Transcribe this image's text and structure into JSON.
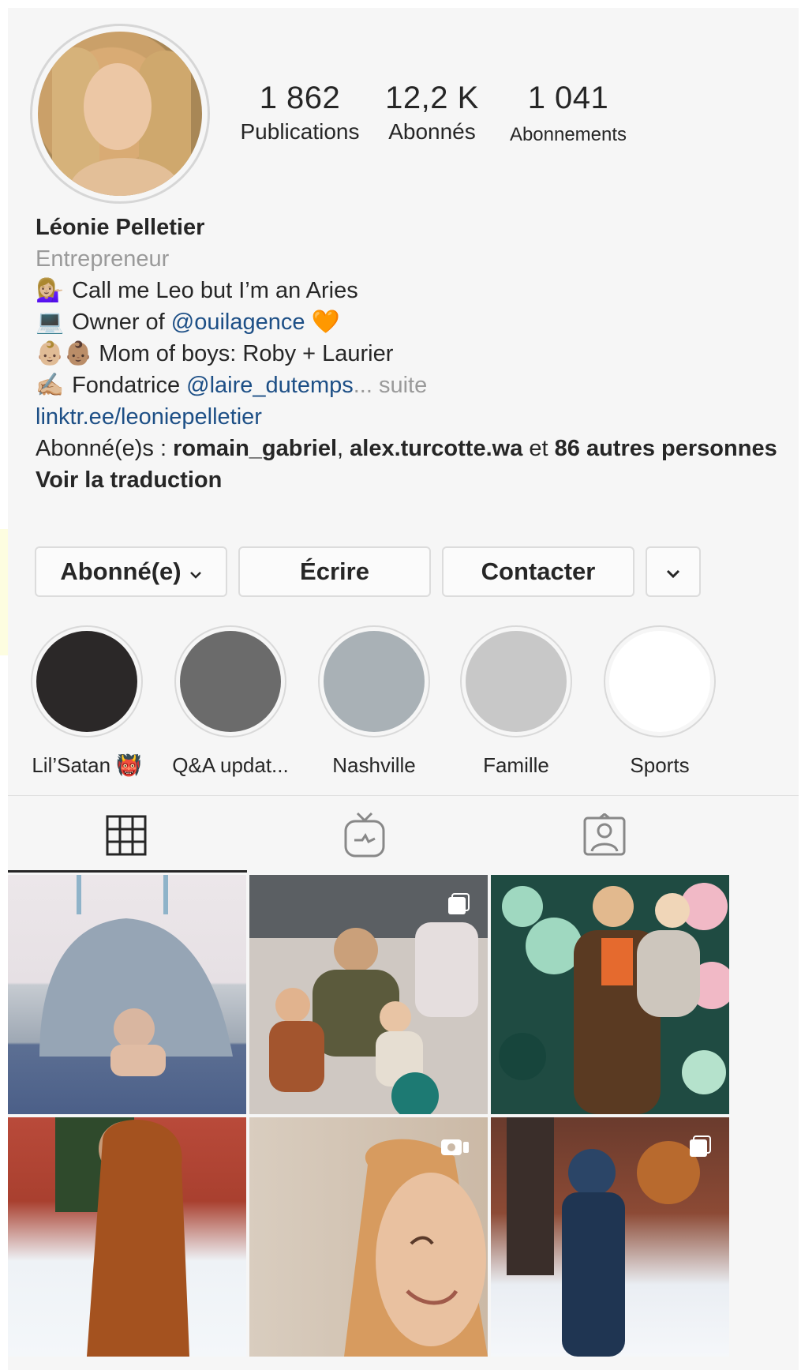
{
  "profile": {
    "stats": [
      {
        "value": "1 862",
        "label": "Publications"
      },
      {
        "value": "12,2 K",
        "label": "Abonnés"
      },
      {
        "value": "1 041",
        "label": "Abonnements"
      }
    ],
    "name": "Léonie Pelletier",
    "category": "Entrepreneur",
    "bio_lines": {
      "line1_emoji": "💁🏼‍♀️",
      "line1_text": "Call me Leo but I’m an Aries",
      "line2_emoji": "💻",
      "line2_text": "Owner of ",
      "line2_mention": "@ouilagence",
      "line2_suffix": "🧡",
      "line3_emoji": "👶🏼👶🏽",
      "line3_text": "Mom of boys: Roby + Laurier",
      "line4_emoji": "✍🏼",
      "line4_text": "Fondatrice ",
      "line4_mention": "@laire_dutemps",
      "line4_more": "... suite"
    },
    "website": "linktr.ee/leoniepelletier",
    "followed_by_prefix": "Abonné(e)s : ",
    "followed_by_user1": "romain_gabriel",
    "followed_by_sep": ", ",
    "followed_by_user2": "alex.turcotte.wa",
    "followed_by_and": " et ",
    "followed_by_rest": "86 autres personnes",
    "translate": "Voir la traduction"
  },
  "buttons": {
    "following": "Abonné(e)",
    "message": "Écrire",
    "contact": "Contacter"
  },
  "highlights": [
    {
      "label": "Lil’Satan 👹",
      "color": "#2b2828"
    },
    {
      "label": "Q&A updat...",
      "color": "#6b6b6b"
    },
    {
      "label": "Nashville",
      "color": "#a9b1b6"
    },
    {
      "label": "Famille",
      "color": "#c8c8c8"
    },
    {
      "label": "Sports",
      "color": "#ffffff"
    }
  ],
  "tabs": [
    {
      "name": "grid-icon",
      "active": true
    },
    {
      "name": "igtv-icon",
      "active": false
    },
    {
      "name": "tagged-icon",
      "active": false
    }
  ],
  "colors": {
    "link": "#1d4f86",
    "muted": "#9a9a9a",
    "text": "#262626"
  }
}
